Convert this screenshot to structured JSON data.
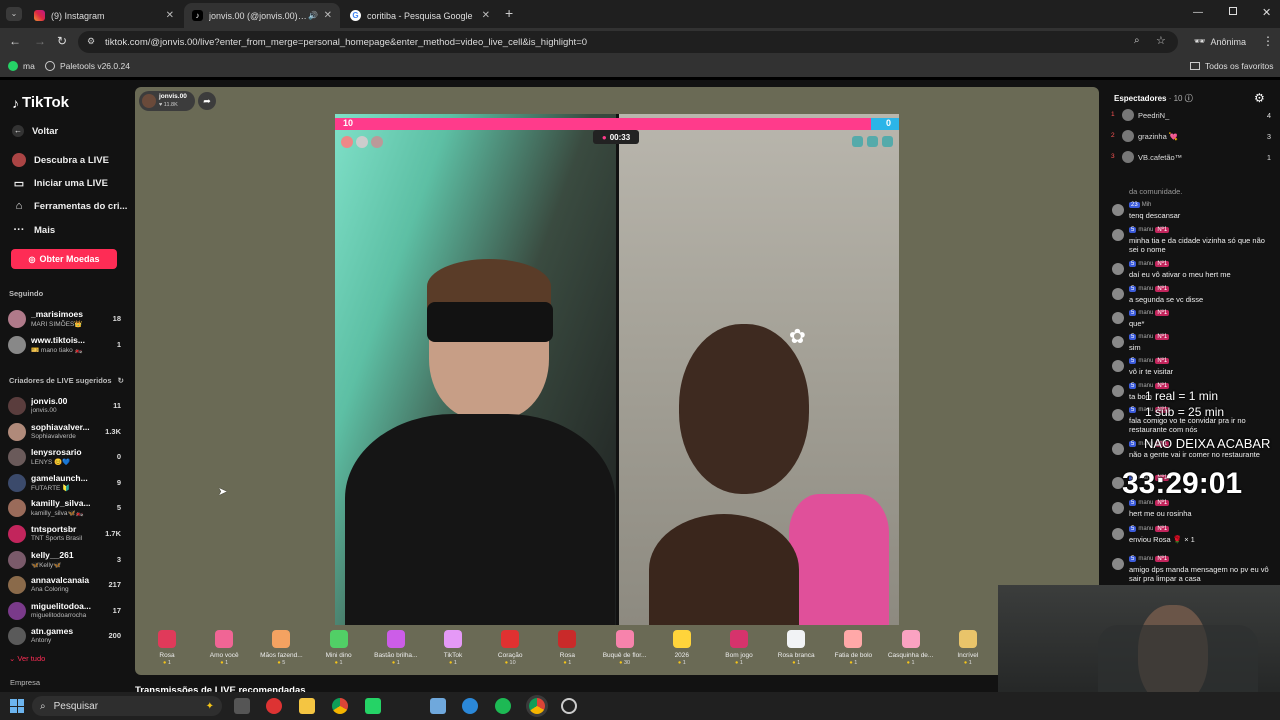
{
  "browser": {
    "tabs": [
      {
        "title": "(9) Instagram",
        "favicon": "instagram-icon"
      },
      {
        "title": "jonvis.00 (@jonvis.00) comenta",
        "favicon": "tiktok-icon"
      },
      {
        "title": "coritiba - Pesquisa Google",
        "favicon": "google-icon"
      }
    ],
    "new_tab": "+",
    "url": "tiktok.com/@jonvis.00/live?enter_from_merge=personal_homepage&enter_method=video_live_cell&is_highlight=0",
    "profile_label": "Anônima",
    "bookmarks": [
      {
        "label": "ma",
        "icon": "whatsapp-icon"
      },
      {
        "label": "Paletools v26.0.24",
        "icon": "globe-icon"
      }
    ],
    "all_favorites": "Todos os favoritos"
  },
  "sidebar": {
    "logo": "TikTok",
    "back": "Voltar",
    "links": [
      "Descubra a LIVE",
      "Iniciar uma LIVE",
      "Ferramentas do cri...",
      "Mais"
    ],
    "coins_button": "Obter Moedas",
    "following_title": "Seguindo",
    "following": [
      {
        "name": "_marisimoes",
        "sub": "MARI SIMÕES👑",
        "count": "18"
      },
      {
        "name": "www.tiktois...",
        "sub": "🎫 mano tiako 🏍️",
        "count": "1"
      }
    ],
    "suggested_title": "Criadores de LIVE sugeridos",
    "suggested": [
      {
        "name": "jonvis.00",
        "sub": "jonvis.00",
        "count": "11"
      },
      {
        "name": "sophiavalver...",
        "sub": "Sophiavalverde",
        "count": "1.3K"
      },
      {
        "name": "lenysrosario",
        "sub": "LENYS 😊💙",
        "count": "0"
      },
      {
        "name": "gamelaunch...",
        "sub": "FUTARTE 🔰",
        "count": "9"
      },
      {
        "name": "kamilly_silva...",
        "sub": "kamilly_silva🦋🏍️",
        "count": "5"
      },
      {
        "name": "tntsportsbr",
        "sub": "TNT Sports Brasil",
        "count": "1.7K"
      },
      {
        "name": "kelly__261",
        "sub": "🦋Kelly🦋",
        "count": "3"
      },
      {
        "name": "annavalcanaia",
        "sub": "Ana Coloring",
        "count": "217"
      },
      {
        "name": "miguelitodoa...",
        "sub": "miguelitodoarrocha",
        "count": "17"
      },
      {
        "name": "atn.games",
        "sub": "Antony",
        "count": "200"
      }
    ],
    "see_all": "Ver tudo",
    "company": "Empresa"
  },
  "player": {
    "host_name": "jonvis.00",
    "host_likes": "11.8K",
    "battle_left_score": "10",
    "battle_right_score": "0",
    "timer": "00:33",
    "recommended_title": "Transmissões de LIVE recomendadas"
  },
  "gifts": [
    {
      "label": "Rosa",
      "price": "1",
      "color": "#e03a5a"
    },
    {
      "label": "Amo você",
      "price": "1",
      "color": "#f06595"
    },
    {
      "label": "Mãos fazend...",
      "price": "5",
      "color": "#f4a261"
    },
    {
      "label": "Mini dino",
      "price": "1",
      "color": "#51cf66"
    },
    {
      "label": "Bastão brilha...",
      "price": "1",
      "color": "#cc5de8"
    },
    {
      "label": "TikTok",
      "price": "1",
      "color": "#e599f7"
    },
    {
      "label": "Coração",
      "price": "10",
      "color": "#e03131"
    },
    {
      "label": "Rosa",
      "price": "1",
      "color": "#c92a2a"
    },
    {
      "label": "Buquê de flor...",
      "price": "30",
      "color": "#f783ac"
    },
    {
      "label": "2026",
      "price": "1",
      "color": "#ffd43b"
    },
    {
      "label": "Bom jogo",
      "price": "1",
      "color": "#d6336c"
    },
    {
      "label": "Rosa branca",
      "price": "1",
      "color": "#f1f3f5"
    },
    {
      "label": "Fatia de bolo",
      "price": "1",
      "color": "#ffa8a8"
    },
    {
      "label": "Casquinha de...",
      "price": "1",
      "color": "#faa2c1"
    },
    {
      "label": "Incrível",
      "price": "1",
      "color": "#e9c46a"
    }
  ],
  "viewers": {
    "title": "Espectadores",
    "count": "10",
    "list": [
      {
        "rank": "1",
        "name": "PeedriN_",
        "score": "4"
      },
      {
        "rank": "2",
        "name": "grazinha 💘",
        "score": "3"
      },
      {
        "rank": "3",
        "name": "VB.cafetão™",
        "score": "1"
      }
    ]
  },
  "chat": {
    "notice": "da comunidade.",
    "messages": [
      {
        "badge1": "23",
        "user": "Mih",
        "badge2": "",
        "text": "tenq descansar"
      },
      {
        "badge1": "5",
        "user": "manu",
        "badge2": "Nº1",
        "text": "minha tia e da cidade vizinha só que não sei o nome"
      },
      {
        "badge1": "5",
        "user": "manu",
        "badge2": "Nº1",
        "text": "daí eu vô ativar o meu hert me"
      },
      {
        "badge1": "5",
        "user": "manu",
        "badge2": "Nº1",
        "text": "a segunda se vc disse"
      },
      {
        "badge1": "5",
        "user": "manu",
        "badge2": "Nº1",
        "text": "que*"
      },
      {
        "badge1": "5",
        "user": "manu",
        "badge2": "Nº1",
        "text": "sim"
      },
      {
        "badge1": "5",
        "user": "manu",
        "badge2": "Nº1",
        "text": "vô ir te visitar"
      },
      {
        "badge1": "5",
        "user": "manu",
        "badge2": "Nº1",
        "text": "ta bom"
      },
      {
        "badge1": "5",
        "user": "manu",
        "badge2": "Nº1",
        "text": "fala comigo vo te convidar pra ir no restaurante com nós"
      },
      {
        "badge1": "5",
        "user": "manu",
        "badge2": "Nº1",
        "text": "não a gente vai ir comer no restaurante"
      },
      {
        "badge1": "5",
        "user": "manu",
        "badge2": "Nº1",
        "text": ""
      },
      {
        "badge1": "5",
        "user": "manu",
        "badge2": "Nº1",
        "text": "hert me ou rosinha"
      },
      {
        "badge1": "5",
        "user": "manu",
        "badge2": "Nº1",
        "text": "enviou Rosa 🌹 × 1"
      },
      {
        "badge1": "5",
        "user": "manu",
        "badge2": "Nº1",
        "text": "amigo dps manda mensagem no pv eu vô sair pra limpar a casa"
      }
    ]
  },
  "overlay": {
    "line1": "1 real = 1 min",
    "line2": "1 sub = 25 min",
    "line3": "NAO DEIXA ACABAR",
    "timer": "33:29:01"
  },
  "taskbar": {
    "search_placeholder": "Pesquisar"
  },
  "colors": {
    "tiktok_pink": "#fe2c55",
    "battle_pink": "#ff3b8b",
    "battle_blue": "#2bb5e8"
  }
}
